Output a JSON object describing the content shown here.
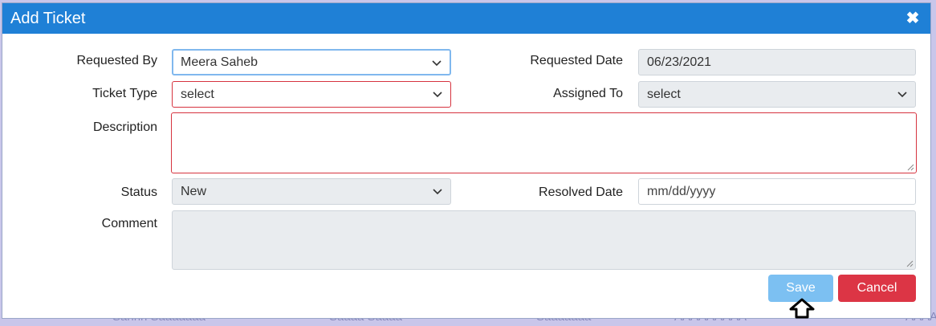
{
  "background": {
    "fragments": [
      "Sahhh Saaaaaaa",
      "Saaaa Saaaa",
      "Saaaaaaa",
      "AAAAAAAAA",
      "AAAA"
    ]
  },
  "modal": {
    "title": "Add Ticket",
    "close_icon": "close-icon"
  },
  "form": {
    "requested_by": {
      "label": "Requested By",
      "value": "Meera Saheb"
    },
    "requested_date": {
      "label": "Requested Date",
      "value": "06/23/2021"
    },
    "ticket_type": {
      "label": "Ticket Type",
      "value": "select"
    },
    "assigned_to": {
      "label": "Assigned To",
      "value": "select"
    },
    "description": {
      "label": "Description",
      "value": ""
    },
    "status": {
      "label": "Status",
      "value": "New"
    },
    "resolved_date": {
      "label": "Resolved Date",
      "placeholder": "mm/dd/yyyy"
    },
    "comment": {
      "label": "Comment",
      "value": ""
    }
  },
  "buttons": {
    "save": "Save",
    "cancel": "Cancel"
  },
  "colors": {
    "header": "#1f80d6",
    "save": "#7cc0f2",
    "cancel": "#dc3545",
    "error_border": "#d6333f"
  }
}
